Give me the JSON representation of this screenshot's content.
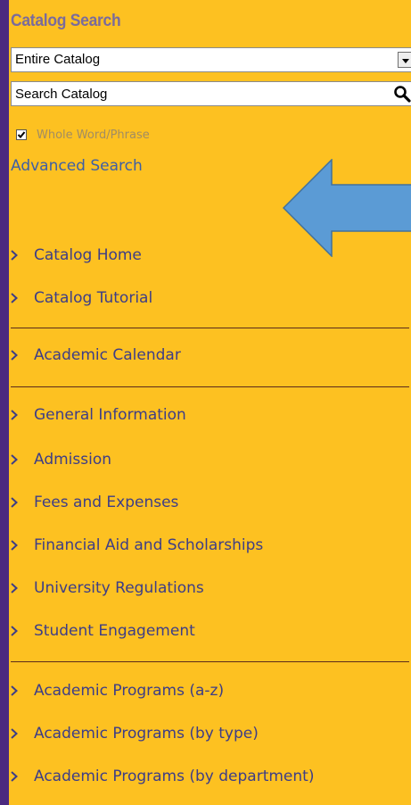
{
  "search": {
    "title": "Catalog Search",
    "scope_value": "Entire Catalog",
    "input_placeholder": "Search Catalog",
    "whole_word_label": "Whole Word/Phrase",
    "whole_word_checked": true,
    "advanced_link": "Advanced Search"
  },
  "nav": {
    "groups": [
      [
        "Catalog Home",
        "Catalog Tutorial"
      ],
      [
        "Academic Calendar"
      ],
      [
        "General Information",
        "Admission",
        "Fees and Expenses",
        "Financial Aid and Scholarships",
        "University Regulations",
        "Student Engagement"
      ],
      [
        "Academic Programs (a-z)",
        "Academic Programs (by type)",
        "Academic Programs (by department)"
      ]
    ]
  },
  "annotation": {
    "arrow_icon": "left-arrow-icon",
    "arrow_color": "#5b9bd5"
  },
  "colors": {
    "frame": "#4b2a7f",
    "panel": "#fdc121",
    "link": "#3d5fa6"
  }
}
